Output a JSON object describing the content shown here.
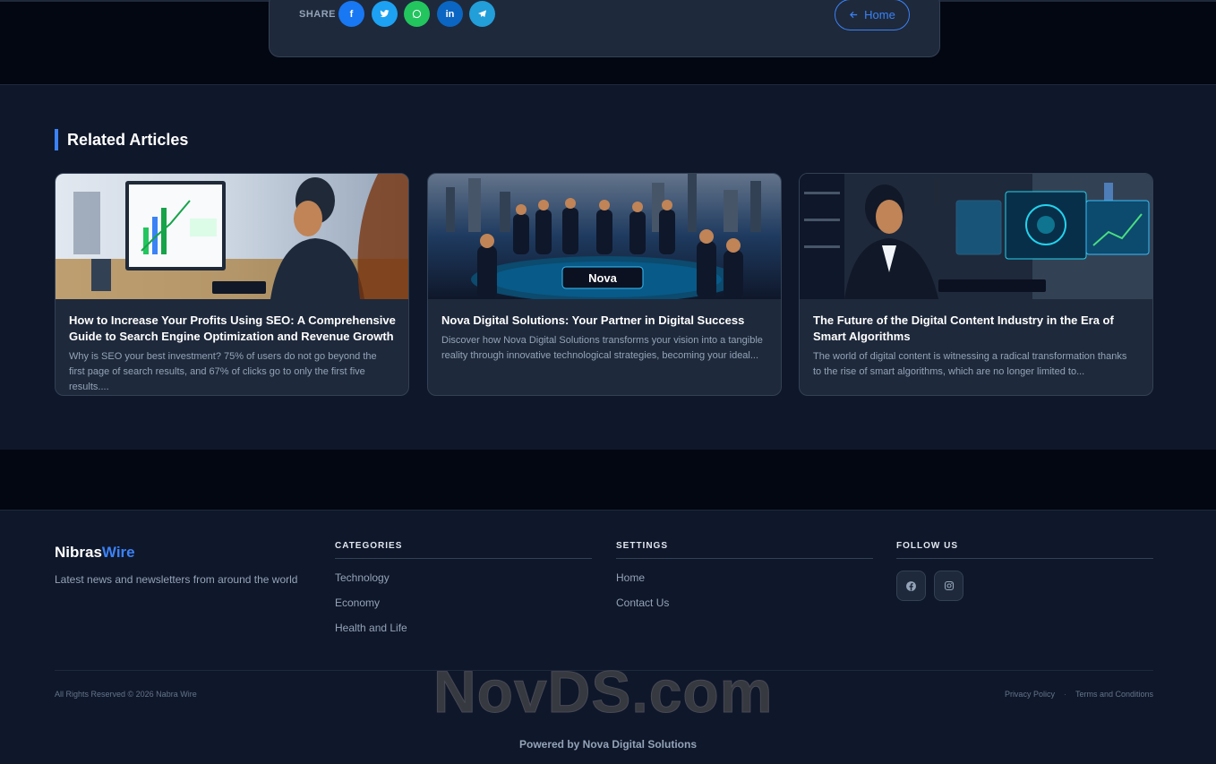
{
  "share": {
    "label": "SHARE",
    "buttons": [
      {
        "name": "facebook",
        "icon": "facebook-icon",
        "glyph": "f",
        "color": "#1877f2"
      },
      {
        "name": "twitter",
        "icon": "twitter-icon",
        "glyph": "t",
        "color": "#1da1f2"
      },
      {
        "name": "whatsapp",
        "icon": "whatsapp-icon",
        "glyph": "w",
        "color": "#22c55e"
      },
      {
        "name": "linkedin",
        "icon": "linkedin-icon",
        "glyph": "in",
        "color": "#0a66c2"
      },
      {
        "name": "telegram",
        "icon": "telegram-icon",
        "glyph": "➤",
        "color": "#229ed9"
      }
    ],
    "home_label": "Home",
    "home_icon": "arrow-left-icon"
  },
  "related": {
    "title": "Related Articles",
    "articles": [
      {
        "title": "How to Increase Your Profits Using SEO: A Comprehensive Guide to Search Engine Optimization and Revenue Growth",
        "excerpt": "Why is SEO your best investment? 75% of users do not go beyond the first page of search results, and 67% of clicks go to only the first five results...."
      },
      {
        "title": "Nova Digital Solutions: Your Partner in Digital Success",
        "excerpt": "Discover how Nova Digital Solutions transforms your vision into a tangible reality through innovative technological strategies, becoming your ideal..."
      },
      {
        "title": "The Future of the Digital Content Industry in the Era of Smart Algorithms",
        "excerpt": "The world of digital content is witnessing a radical transformation thanks to the rise of smart algorithms, which are no longer limited to..."
      }
    ]
  },
  "footer": {
    "brand_main": "Nibras",
    "brand_accent": "Wire",
    "tagline": "Latest news and newsletters from around the world",
    "categories": {
      "title": "CATEGORIES",
      "links": [
        "Technology",
        "Economy",
        "Health and Life"
      ]
    },
    "settings": {
      "title": "SETTINGS",
      "links": [
        "Home",
        "Contact Us"
      ]
    },
    "follow": {
      "title": "FOLLOW US",
      "icons": [
        "facebook-icon",
        "instagram-icon"
      ]
    },
    "copyright": "All Rights Reserved © 2026 Nabra Wire",
    "privacy": "Privacy Policy",
    "terms": "Terms and Conditions",
    "powered": "Powered by Nova Digital Solutions"
  },
  "watermark": "NovDS.com"
}
